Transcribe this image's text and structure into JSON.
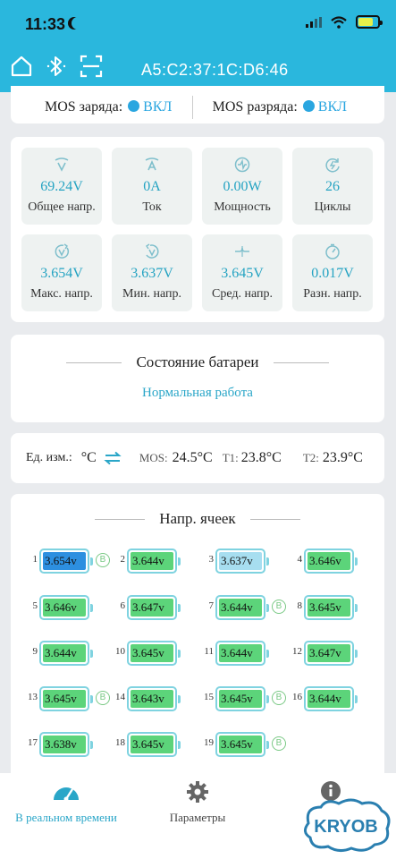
{
  "status_bar": {
    "time": "11:33"
  },
  "header": {
    "mac": "A5:C2:37:1C:D6:46"
  },
  "mos": {
    "charge_label": "MOS заряда:",
    "charge_value": "ВКЛ",
    "discharge_label": "MOS разряда:",
    "discharge_value": "ВКЛ",
    "on_color": "#2aa6e0"
  },
  "metrics": [
    {
      "icon": "voltage-v-icon",
      "value": "69.24V",
      "label": "Общее напр."
    },
    {
      "icon": "current-a-icon",
      "value": "0A",
      "label": "Ток"
    },
    {
      "icon": "power-icon",
      "value": "0.00W",
      "label": "Мощность"
    },
    {
      "icon": "cycles-icon",
      "value": "26",
      "label": "Циклы"
    },
    {
      "icon": "max-voltage-icon",
      "value": "3.654V",
      "label": "Макс. напр."
    },
    {
      "icon": "min-voltage-icon",
      "value": "3.637V",
      "label": "Мин. напр."
    },
    {
      "icon": "avg-voltage-icon",
      "value": "3.645V",
      "label": "Сред. напр."
    },
    {
      "icon": "diff-voltage-icon",
      "value": "0.017V",
      "label": "Разн. напр."
    }
  ],
  "battery_status": {
    "title": "Состояние батареи",
    "value": "Нормальная работа"
  },
  "temperature": {
    "unit_label": "Ед. изм.:",
    "unit": "°C",
    "mos_label": "MOS:",
    "mos_value": "24.5°C",
    "t1_label": "T1:",
    "t1_value": "23.8°C",
    "t2_label": "T2:",
    "t2_value": "23.9°C"
  },
  "cells": {
    "title": "Напр. ячеек",
    "balance_glyph": "B",
    "list": [
      {
        "n": "1",
        "v": "3.654v",
        "state": "max",
        "balancing": true
      },
      {
        "n": "2",
        "v": "3.644v",
        "state": "normal",
        "balancing": false
      },
      {
        "n": "3",
        "v": "3.637v",
        "state": "min",
        "balancing": false
      },
      {
        "n": "4",
        "v": "3.646v",
        "state": "normal",
        "balancing": false
      },
      {
        "n": "5",
        "v": "3.646v",
        "state": "normal",
        "balancing": false
      },
      {
        "n": "6",
        "v": "3.647v",
        "state": "normal",
        "balancing": false
      },
      {
        "n": "7",
        "v": "3.644v",
        "state": "normal",
        "balancing": true
      },
      {
        "n": "8",
        "v": "3.645v",
        "state": "normal",
        "balancing": false
      },
      {
        "n": "9",
        "v": "3.644v",
        "state": "normal",
        "balancing": false
      },
      {
        "n": "10",
        "v": "3.645v",
        "state": "normal",
        "balancing": false
      },
      {
        "n": "11",
        "v": "3.644v",
        "state": "normal",
        "balancing": false
      },
      {
        "n": "12",
        "v": "3.647v",
        "state": "normal",
        "balancing": false
      },
      {
        "n": "13",
        "v": "3.645v",
        "state": "normal",
        "balancing": true
      },
      {
        "n": "14",
        "v": "3.643v",
        "state": "normal",
        "balancing": false
      },
      {
        "n": "15",
        "v": "3.645v",
        "state": "normal",
        "balancing": true
      },
      {
        "n": "16",
        "v": "3.644v",
        "state": "normal",
        "balancing": false
      },
      {
        "n": "17",
        "v": "3.638v",
        "state": "normal",
        "balancing": false
      },
      {
        "n": "18",
        "v": "3.645v",
        "state": "normal",
        "balancing": false
      },
      {
        "n": "19",
        "v": "3.645v",
        "state": "normal",
        "balancing": true
      }
    ]
  },
  "nav": {
    "realtime": "В реальном времени",
    "params": "Параметры",
    "info": "Ин"
  },
  "watermark": {
    "text": "KRYOB"
  },
  "colors": {
    "header": "#2ab7dd",
    "accent": "#24a3c2",
    "cell_normal": "#5cd47a",
    "cell_max": "#2d8fe0",
    "cell_min": "#a7def0"
  }
}
